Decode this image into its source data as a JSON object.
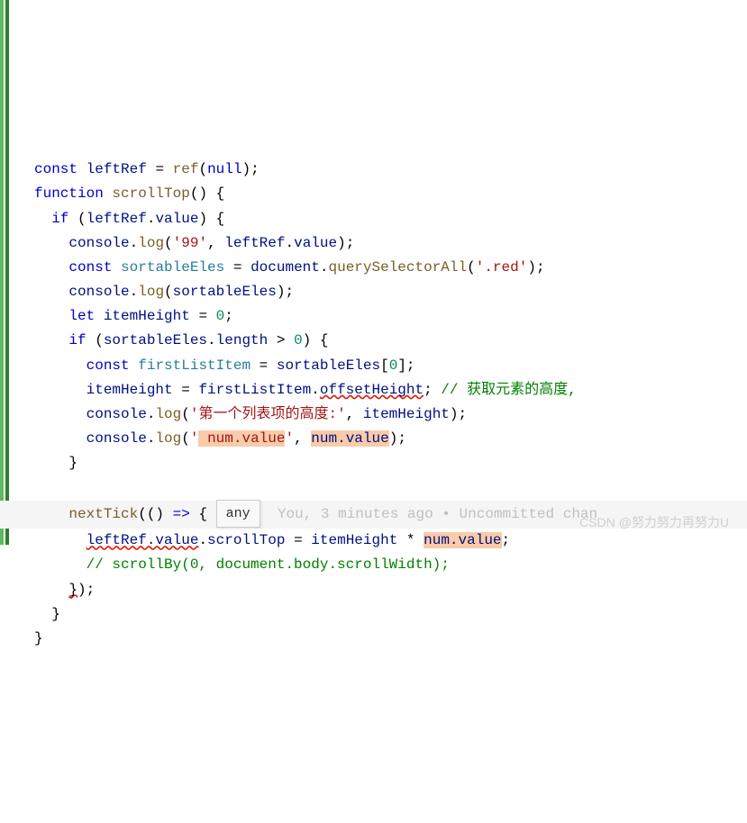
{
  "code": {
    "line1": {
      "kw_const": "const",
      "var_leftRef": "leftRef",
      "eq": " = ",
      "fn_ref": "ref",
      "lparen": "(",
      "null": "null",
      "rparen": ")",
      "semi": ";"
    },
    "line2": {
      "kw_function": "function",
      "fn_name": "scrollTop",
      "parens": "()",
      "brace": " {"
    },
    "line3": {
      "kw_if": "if",
      "lparen": " (",
      "var": "leftRef",
      "dot": ".",
      "prop": "value",
      "rparen": ")",
      "brace": " {"
    },
    "line4": {
      "obj": "console",
      "dot": ".",
      "method": "log",
      "lparen": "(",
      "str": "'99'",
      "comma": ", ",
      "var": "leftRef",
      "dot2": ".",
      "prop": "value",
      "rparen": ")",
      "semi": ";"
    },
    "line5": {
      "kw_const": "const",
      "var": "sortableEles",
      "eq": " = ",
      "obj": "document",
      "dot": ".",
      "method": "querySelectorAll",
      "lparen": "(",
      "str": "'.red'",
      "rparen": ")",
      "semi": ";"
    },
    "line6": {
      "obj": "console",
      "dot": ".",
      "method": "log",
      "lparen": "(",
      "var": "sortableEles",
      "rparen": ")",
      "semi": ";"
    },
    "line7": {
      "kw_let": "let",
      "var": "itemHeight",
      "eq": " = ",
      "num": "0",
      "semi": ";"
    },
    "line8": {
      "kw_if": "if",
      "lparen": " (",
      "var": "sortableEles",
      "dot": ".",
      "prop": "length",
      "gt": " > ",
      "num": "0",
      "rparen": ")",
      "brace": " {"
    },
    "line9": {
      "kw_const": "const",
      "var": "firstListItem",
      "eq": " = ",
      "var2": "sortableEles",
      "lbracket": "[",
      "num": "0",
      "rbracket": "]",
      "semi": ";"
    },
    "line10": {
      "var": "itemHeight",
      "eq": " = ",
      "var2": "firstListItem",
      "dot": ".",
      "prop": "offsetHeight",
      "semi": ";",
      "comment": " // 获取元素的高度,"
    },
    "line11": {
      "obj": "console",
      "dot": ".",
      "method": "log",
      "lparen": "(",
      "str": "'第一个列表项的高度:'",
      "comma": ", ",
      "var": "itemHeight",
      "rparen": ")",
      "semi": ";"
    },
    "line12": {
      "obj": "console",
      "dot": ".",
      "method": "log",
      "lparen": "(",
      "str_prefix": "'",
      "str_hl": " num.value",
      "str_suffix": "'",
      "comma": ", ",
      "var_hl": "num.value",
      "rparen": ")",
      "semi": ";"
    },
    "line13": {
      "brace": "}"
    },
    "line15": {
      "fn": "nextTick",
      "lparen": "(",
      "arrow_params": "()",
      "arrow": " => ",
      "brace": "{",
      "tooltip": "any",
      "blame": "You, 3 minutes ago • Uncommitted chan"
    },
    "line16": {
      "var_sq": "leftRef.value",
      "dot": ".",
      "prop": "scrollTop",
      "eq": " = ",
      "var2": "itemHeight",
      "mult": " * ",
      "var_hl": "num.value",
      "semi": ";"
    },
    "line17": {
      "comment": "// scrollBy(0, document.body.scrollWidth);"
    },
    "line18": {
      "brace_sq": "}",
      "rparen": ")",
      "semi": ";"
    },
    "line19": {
      "brace": "}"
    },
    "line20": {
      "brace": "}"
    }
  },
  "tooltip_text": "any",
  "blame_text": "You, 3 minutes ago • Uncommitted chan",
  "watermark": "CSDN @努力努力再努力U"
}
